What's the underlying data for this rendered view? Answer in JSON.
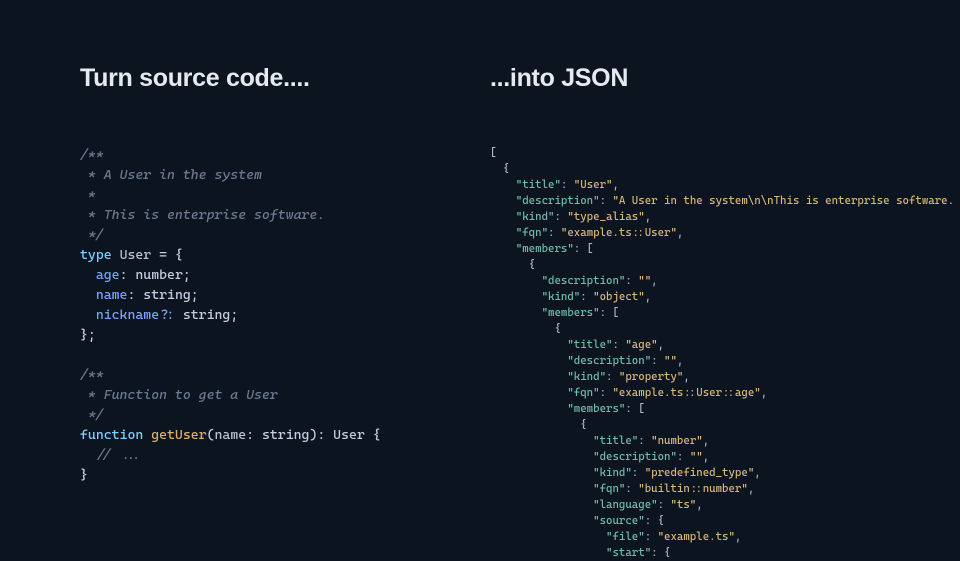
{
  "headings": {
    "left": "Turn source code....",
    "right": "...into JSON"
  },
  "source_code": {
    "comment1_l1": "/**",
    "comment1_l2": " * A User in the system",
    "comment1_l3": " *",
    "comment1_l4": " * This is enterprise software.",
    "comment1_l5": " */",
    "type_kw": "type",
    "type_name": "User",
    "eq": " = {",
    "prop1": "age",
    "prop1_type": "number",
    "prop2": "name",
    "prop2_type": "string",
    "prop3": "nickname",
    "prop3_opt": "?",
    "prop3_type": "string",
    "close_brace": "};",
    "comment2_l1": "/**",
    "comment2_l2": " * Function to get a User",
    "comment2_l3": " */",
    "fn_kw": "function",
    "fn_name": "getUser",
    "fn_param": "name",
    "fn_param_type": "string",
    "fn_ret": "User",
    "fn_open": " {",
    "fn_body": "  // ...",
    "fn_close": "}"
  },
  "json_output": {
    "l0": "[",
    "l1": "  {",
    "l1a_k": "\"title\"",
    "l1a_v": "\"User\"",
    "l2_k": "\"description\"",
    "l2_v": "\"A User in the system\\n\\nThis is enterprise software.",
    "l3_k": "\"kind\"",
    "l3_v": "\"type_alias\"",
    "l4_k": "\"fqn\"",
    "l4_v": "\"example.ts::User\"",
    "l5_k": "\"members\"",
    "l6": "      {",
    "l7_k": "\"description\"",
    "l7_v": "\"\"",
    "l8_k": "\"kind\"",
    "l8_v": "\"object\"",
    "l9_k": "\"members\"",
    "l10": "          {",
    "l11_k": "\"title\"",
    "l11_v": "\"age\"",
    "l12_k": "\"description\"",
    "l12_v": "\"\"",
    "l13_k": "\"kind\"",
    "l13_v": "\"property\"",
    "l14_k": "\"fqn\"",
    "l14_v": "\"example.ts::User::age\"",
    "l15_k": "\"members\"",
    "l16": "              {",
    "l17_k": "\"title\"",
    "l17_v": "\"number\"",
    "l18_k": "\"description\"",
    "l18_v": "\"\"",
    "l19_k": "\"kind\"",
    "l19_v": "\"predefined_type\"",
    "l20_k": "\"fqn\"",
    "l20_v": "\"builtin::number\"",
    "l21_k": "\"language\"",
    "l21_v": "\"ts\"",
    "l22_k": "\"source\"",
    "l23_k": "\"file\"",
    "l23_v": "\"example.ts\"",
    "l24_k": "\"start\""
  }
}
